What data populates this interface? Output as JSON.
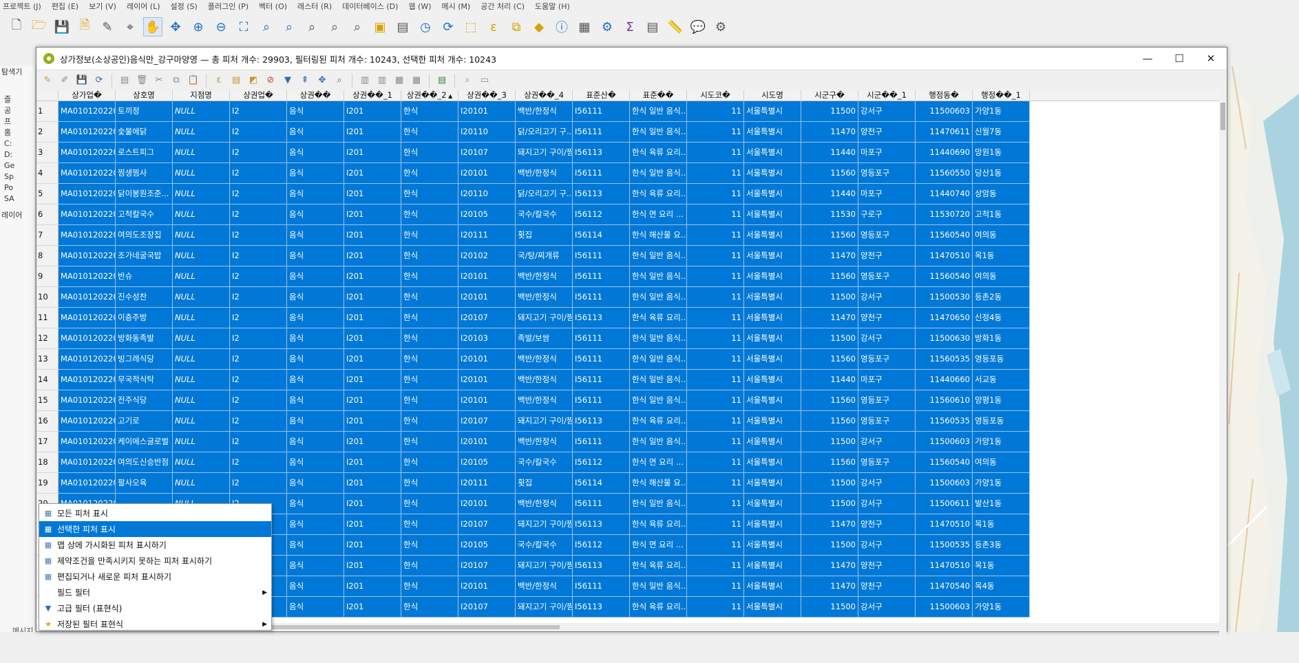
{
  "menubar": [
    "프로젝트 (J)",
    "편집 (E)",
    "보기 (V)",
    "레이어 (L)",
    "설정 (S)",
    "플러그인 (P)",
    "벡터 (O)",
    "래스터 (R)",
    "데이터베이스 (D)",
    "웹 (W)",
    "메시 (M)",
    "공간 처리 (C)",
    "도움말 (H)"
  ],
  "left_panel": {
    "browser_title": "탐색기",
    "browser_items": [
      "즐",
      "공",
      "프",
      "홈",
      "C:",
      "D:",
      "Ge",
      "Sp",
      "Po",
      "SA"
    ],
    "layers_title": "레이어",
    "message_tab": "메시지"
  },
  "attr_window": {
    "title": "상가정보(소상공인)음식만_강구마양영 — 총 피처 개수: 29903, 필터링된 피처 개수: 10243, 선택한 피처 개수: 10243",
    "min": "—",
    "max": "☐",
    "close": "✕"
  },
  "columns": [
    "상가업�",
    "상호명",
    "지점명",
    "상권업�",
    "상권��",
    "상권��_1",
    "상권��_2",
    "상권��_3",
    "상권��_4",
    "표준산�",
    "표준��",
    "시도코�",
    "시도명",
    "시군구�",
    "시군��_1",
    "행정동�",
    "행정��_1"
  ],
  "sort_indicator": "▲",
  "rows": [
    [
      "1",
      "MA010120220...",
      "토끼정",
      "NULL",
      "I2",
      "음식",
      "I201",
      "한식",
      "I20101",
      "백반/한정식",
      "I56111",
      "한식 일반 음식...",
      "11",
      "서울특별시",
      "11500",
      "강서구",
      "11500603",
      "가양1동"
    ],
    [
      "2",
      "MA010120220...",
      "숯불에닭",
      "NULL",
      "I2",
      "음식",
      "I201",
      "한식",
      "I20110",
      "닭/오리고기 구...",
      "I56111",
      "한식 일반 음식...",
      "11",
      "서울특별시",
      "11470",
      "양천구",
      "11470611",
      "신월7동"
    ],
    [
      "3",
      "MA010120220...",
      "로스트피그",
      "NULL",
      "I2",
      "음식",
      "I201",
      "한식",
      "I20107",
      "돼지고기 구이/찜",
      "I56113",
      "한식 육류 요리...",
      "11",
      "서울특별시",
      "11440",
      "마포구",
      "11440690",
      "망원1동"
    ],
    [
      "4",
      "MA010120220...",
      "찜생찜사",
      "NULL",
      "I2",
      "음식",
      "I201",
      "한식",
      "I20101",
      "백반/한정식",
      "I56111",
      "한식 일반 음식...",
      "11",
      "서울특별시",
      "11560",
      "영등포구",
      "11560550",
      "당산1동"
    ],
    [
      "5",
      "MA010120220...",
      "닭이봉원조준...",
      "NULL",
      "I2",
      "음식",
      "I201",
      "한식",
      "I20110",
      "닭/오리고기 구...",
      "I56113",
      "한식 육류 요리...",
      "11",
      "서울특별시",
      "11440",
      "마포구",
      "11440740",
      "상암동"
    ],
    [
      "6",
      "MA010120220...",
      "고척칼국수",
      "NULL",
      "I2",
      "음식",
      "I201",
      "한식",
      "I20105",
      "국수/칼국수",
      "I56112",
      "한식 면 요리 ...",
      "11",
      "서울특별시",
      "11530",
      "구로구",
      "11530720",
      "고척1동"
    ],
    [
      "7",
      "MA010120220...",
      "여의도조장집",
      "NULL",
      "I2",
      "음식",
      "I201",
      "한식",
      "I20111",
      "횟집",
      "I56114",
      "한식 해산물 요...",
      "11",
      "서울특별시",
      "11560",
      "영등포구",
      "11560540",
      "여의동"
    ],
    [
      "8",
      "MA010120220...",
      "조가네굴국밥",
      "NULL",
      "I2",
      "음식",
      "I201",
      "한식",
      "I20102",
      "국/탕/찌개류",
      "I56111",
      "한식 일반 음식...",
      "11",
      "서울특별시",
      "11470",
      "양천구",
      "11470510",
      "목1동"
    ],
    [
      "9",
      "MA010120220...",
      "반슈",
      "NULL",
      "I2",
      "음식",
      "I201",
      "한식",
      "I20101",
      "백반/한정식",
      "I56111",
      "한식 일반 음식...",
      "11",
      "서울특별시",
      "11560",
      "영등포구",
      "11560540",
      "여의동"
    ],
    [
      "10",
      "MA010120220...",
      "진수성찬",
      "NULL",
      "I2",
      "음식",
      "I201",
      "한식",
      "I20101",
      "백반/한정식",
      "I56111",
      "한식 일반 음식...",
      "11",
      "서울특별시",
      "11500",
      "강서구",
      "11500530",
      "등촌2동"
    ],
    [
      "11",
      "MA010120220...",
      "이층주방",
      "NULL",
      "I2",
      "음식",
      "I201",
      "한식",
      "I20107",
      "돼지고기 구이/찜",
      "I56113",
      "한식 육류 요리...",
      "11",
      "서울특별시",
      "11470",
      "양천구",
      "11470650",
      "신정4동"
    ],
    [
      "12",
      "MA010120220...",
      "방화동족발",
      "NULL",
      "I2",
      "음식",
      "I201",
      "한식",
      "I20103",
      "족발/보쌈",
      "I56111",
      "한식 일반 음식...",
      "11",
      "서울특별시",
      "11500",
      "강서구",
      "11500630",
      "방화1동"
    ],
    [
      "13",
      "MA010120220...",
      "빙그레식당",
      "NULL",
      "I2",
      "음식",
      "I201",
      "한식",
      "I20101",
      "백반/한정식",
      "I56111",
      "한식 일반 음식...",
      "11",
      "서울특별시",
      "11560",
      "영등포구",
      "11560535",
      "영등포동"
    ],
    [
      "14",
      "MA010120220...",
      "무국적식탁",
      "NULL",
      "I2",
      "음식",
      "I201",
      "한식",
      "I20101",
      "백반/한정식",
      "I56111",
      "한식 일반 음식...",
      "11",
      "서울특별시",
      "11440",
      "마포구",
      "11440660",
      "서교동"
    ],
    [
      "15",
      "MA010120220...",
      "전주식당",
      "NULL",
      "I2",
      "음식",
      "I201",
      "한식",
      "I20101",
      "백반/한정식",
      "I56111",
      "한식 일반 음식...",
      "11",
      "서울특별시",
      "11560",
      "영등포구",
      "11560610",
      "양평1동"
    ],
    [
      "16",
      "MA010120220...",
      "고기로",
      "NULL",
      "I2",
      "음식",
      "I201",
      "한식",
      "I20107",
      "돼지고기 구이/찜",
      "I56113",
      "한식 육류 요리...",
      "11",
      "서울특별시",
      "11560",
      "영등포구",
      "11560535",
      "영등포동"
    ],
    [
      "17",
      "MA010120220...",
      "케이에스글로벌",
      "NULL",
      "I2",
      "음식",
      "I201",
      "한식",
      "I20101",
      "백반/한정식",
      "I56111",
      "한식 일반 음식...",
      "11",
      "서울특별시",
      "11500",
      "강서구",
      "11500603",
      "가양1동"
    ],
    [
      "18",
      "MA010120220...",
      "여의도신승반점",
      "NULL",
      "I2",
      "음식",
      "I201",
      "한식",
      "I20105",
      "국수/칼국수",
      "I56112",
      "한식 면 요리 ...",
      "11",
      "서울특별시",
      "11560",
      "영등포구",
      "11560540",
      "여의동"
    ],
    [
      "19",
      "MA010120220...",
      "팔사오육",
      "NULL",
      "I2",
      "음식",
      "I201",
      "한식",
      "I20111",
      "횟집",
      "I56114",
      "한식 해산물 요...",
      "11",
      "서울특별시",
      "11500",
      "강서구",
      "11500603",
      "가양1동"
    ],
    [
      "20",
      "MA010120220...",
      "",
      "NULL",
      "I2",
      "음식",
      "I201",
      "한식",
      "I20101",
      "백반/한정식",
      "I56111",
      "한식 일반 음식...",
      "11",
      "서울특별시",
      "11500",
      "강서구",
      "11500611",
      "발산1동"
    ],
    [
      "21",
      "",
      "",
      "",
      "I2",
      "음식",
      "I201",
      "한식",
      "I20107",
      "돼지고기 구이/찜",
      "I56113",
      "한식 육류 요리...",
      "11",
      "서울특별시",
      "11470",
      "양천구",
      "11470510",
      "목1동"
    ],
    [
      "22",
      "",
      "",
      "",
      "I2",
      "음식",
      "I201",
      "한식",
      "I20105",
      "국수/칼국수",
      "I56112",
      "한식 면 요리 ...",
      "11",
      "서울특별시",
      "11500",
      "강서구",
      "11500535",
      "등촌3동"
    ],
    [
      "23",
      "",
      "",
      "",
      "I2",
      "음식",
      "I201",
      "한식",
      "I20107",
      "돼지고기 구이/찜",
      "I56113",
      "한식 육류 요리...",
      "11",
      "서울특별시",
      "11470",
      "양천구",
      "11470510",
      "목1동"
    ],
    [
      "24",
      "",
      "",
      "",
      "I2",
      "음식",
      "I201",
      "한식",
      "I20101",
      "백반/한정식",
      "I56111",
      "한식 일반 음식...",
      "11",
      "서울특별시",
      "11470",
      "양천구",
      "11470540",
      "목4동"
    ],
    [
      "25",
      "",
      "",
      "",
      "I2",
      "음식",
      "I201",
      "한식",
      "I20107",
      "돼지고기 구이/찜",
      "I56113",
      "한식 육류 요리...",
      "11",
      "서울특별시",
      "11500",
      "강서구",
      "11500603",
      "가양1동"
    ]
  ],
  "filter_menu": [
    {
      "label": "모든 피처 표시",
      "icon": "table-icon",
      "selected": false,
      "submenu": false
    },
    {
      "label": "선택한 피처 표시",
      "icon": "selected-features-icon",
      "selected": true,
      "submenu": false
    },
    {
      "label": "맵 상에 가시화된 피처 표시하기",
      "icon": "map-visible-icon",
      "selected": false,
      "submenu": false
    },
    {
      "label": "제약조건을 만족시키지 못하는 피처 표시하기",
      "icon": "constraint-icon",
      "selected": false,
      "submenu": false
    },
    {
      "label": "편집되거나 새로운 피처 표시하기",
      "icon": "edited-features-icon",
      "selected": false,
      "submenu": false
    },
    {
      "label": "필드 필터",
      "icon": "",
      "selected": false,
      "submenu": true
    },
    {
      "label": "고급 필터 (표현식)",
      "icon": "funnel-icon",
      "selected": false,
      "submenu": false
    },
    {
      "label": "저장된 필터 표현식",
      "icon": "star-icon",
      "selected": false,
      "submenu": true
    }
  ],
  "colors": {
    "selection": "#0078d7",
    "header": "#f2f2f2",
    "accent": "#93b023"
  }
}
